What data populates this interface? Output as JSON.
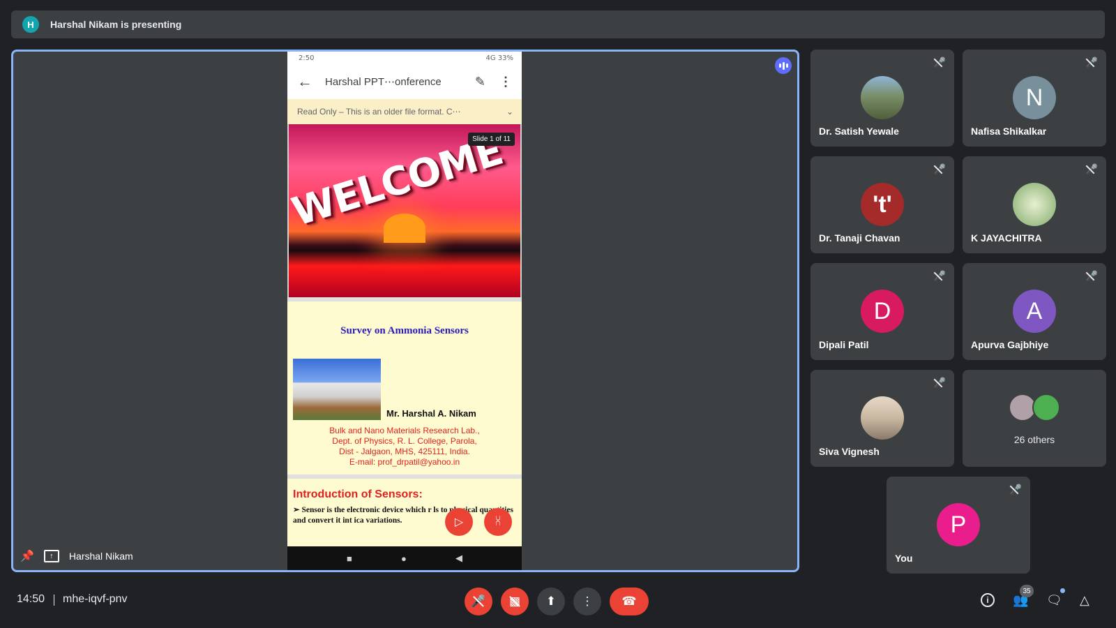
{
  "banner": {
    "avatar_letter": "H",
    "text": "Harshal Nikam is presenting"
  },
  "stage": {
    "presenter_name": "Harshal Nikam",
    "phone": {
      "status_time": "2:50",
      "status_right": "4G 33%",
      "doc_title": "Harshal PPT⋯onference",
      "readonly_text": "Read Only – This is an older file format. C⋯",
      "slide_badge": "Slide 1 of 11",
      "welcome": "WELCOME",
      "survey_title": "Survey on Ammonia Sensors",
      "author": "Mr. Harshal A. Nikam",
      "affil_line1": "Bulk and Nano Materials Research Lab.,",
      "affil_line2": "Dept. of Physics, R. L. College, Parola,",
      "affil_line3": "Dist - Jalgaon, MHS, 425111, India.",
      "affil_line4": "E-mail: prof_drpatil@yahoo.in",
      "intro_title": "Introduction of Sensors:",
      "intro_body": "➢ Sensor is the electronic device which r     ls to physical  quantities and convert it int     ica variations."
    }
  },
  "participants": [
    {
      "name": "Dr. Satish Yewale",
      "letter": "",
      "color": "#6d8a6a"
    },
    {
      "name": "Nafisa Shikalkar",
      "letter": "N",
      "color": "#78909c"
    },
    {
      "name": "Dr. Tanaji Chavan",
      "letter": "'t'",
      "color": "#a52a2a"
    },
    {
      "name": "K JAYACHITRA",
      "letter": "",
      "color": "#9fbf8a"
    },
    {
      "name": "Dipali Patil",
      "letter": "D",
      "color": "#d81b60"
    },
    {
      "name": "Apurva Gajbhiye",
      "letter": "A",
      "color": "#7e57c2"
    },
    {
      "name": "Siva Vignesh",
      "letter": "",
      "color": "#c9b8a0"
    }
  ],
  "others": {
    "label": "26 others"
  },
  "you": {
    "name": "You",
    "letter": "P",
    "color": "#e91e8c"
  },
  "controls": {
    "time": "14:50",
    "meeting_code": "mhe-iqvf-pnv",
    "people_count": "35"
  }
}
